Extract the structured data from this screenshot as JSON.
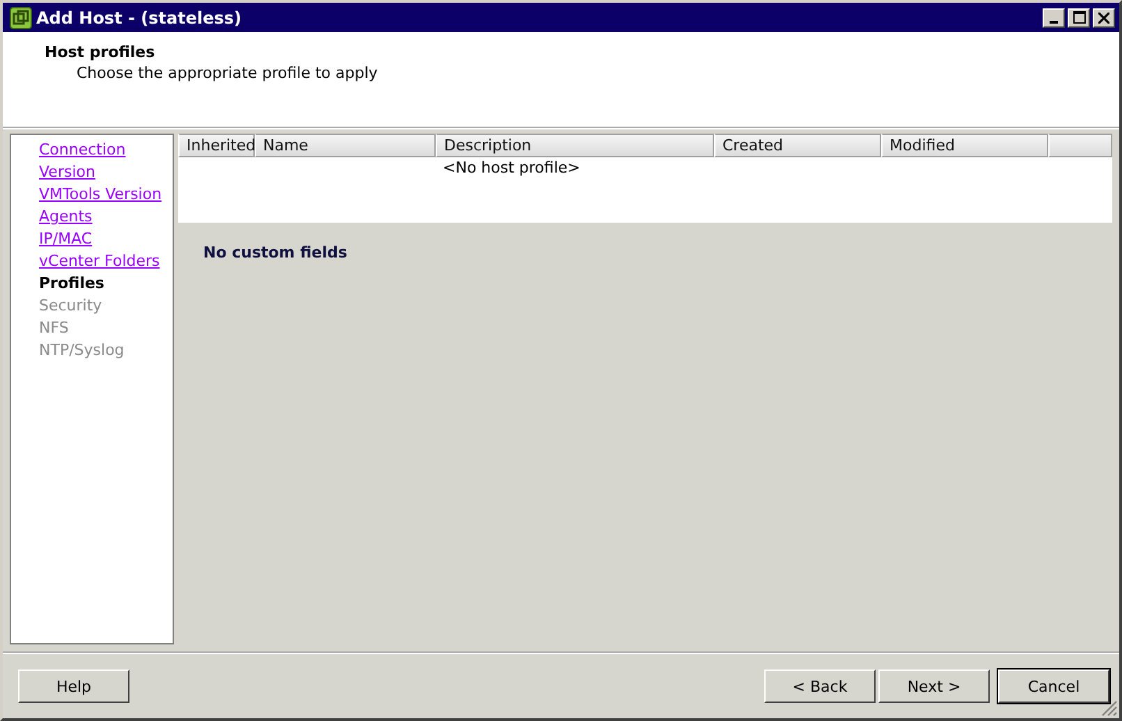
{
  "window": {
    "title": "Add Host - (stateless)"
  },
  "header": {
    "title": "Host profiles",
    "subtitle": "Choose the appropriate profile to apply"
  },
  "steps": [
    {
      "label": "Connection",
      "kind": "visited"
    },
    {
      "label": "Version",
      "kind": "visited"
    },
    {
      "label": "VMTools Version",
      "kind": "visited"
    },
    {
      "label": "Agents",
      "kind": "visited"
    },
    {
      "label": "IP/MAC",
      "kind": "visited"
    },
    {
      "label": "vCenter Folders",
      "kind": "visited"
    },
    {
      "label": "Profiles",
      "kind": "current"
    },
    {
      "label": "Security",
      "kind": "disabled"
    },
    {
      "label": "NFS",
      "kind": "disabled"
    },
    {
      "label": "NTP/Syslog",
      "kind": "disabled"
    }
  ],
  "table": {
    "columns": [
      "Inherited",
      "Name",
      "Description",
      "Created",
      "Modified"
    ],
    "empty_text": "<No host profile>"
  },
  "custom_fields": "No custom fields",
  "buttons": {
    "help": "Help",
    "back": "< Back",
    "next": "Next >",
    "cancel": "Cancel"
  }
}
